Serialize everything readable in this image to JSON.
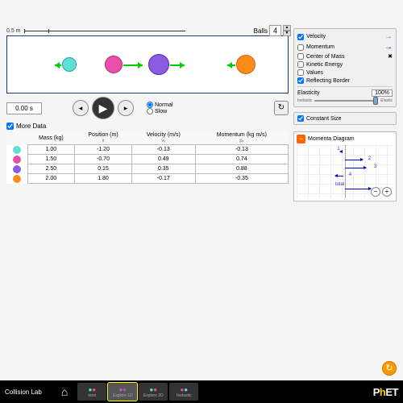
{
  "ruler_label": "0.5 m",
  "balls_control": {
    "label": "Balls",
    "value": "4"
  },
  "time": "0.00 s",
  "speed": {
    "normal": "Normal",
    "slow": "Slow"
  },
  "more_data": "More Data",
  "table": {
    "headers": {
      "mass": "Mass (kg)",
      "position": "Position (m)",
      "position_sub": "x",
      "velocity": "Velocity (m/s)",
      "velocity_sub": "vₓ",
      "momentum": "Momentum (kg m/s)",
      "momentum_sub": "pₓ"
    },
    "rows": [
      {
        "mass": "1.00",
        "pos": "-1.20",
        "vel": "-0.13",
        "mom": "-0.13"
      },
      {
        "mass": "1.50",
        "pos": "-0.70",
        "vel": "0.49",
        "mom": "0.74"
      },
      {
        "mass": "2.50",
        "pos": "0.15",
        "vel": "0.35",
        "mom": "0.88"
      },
      {
        "mass": "2.00",
        "pos": "1.80",
        "vel": "-0.17",
        "mom": "-0.35"
      }
    ]
  },
  "options": {
    "velocity": "Velocity",
    "momentum": "Momentum",
    "com": "Center of Mass",
    "ke": "Kinetic Energy",
    "values": "Values",
    "reflecting": "Reflecting Border"
  },
  "elasticity": {
    "label": "Elasticity",
    "value": "100%",
    "inelastic": "Inelastic",
    "elastic": "Elastic"
  },
  "constant_size": "Constant Size",
  "diagram": {
    "title": "Momenta Diagram",
    "total": "total",
    "labels": [
      "1",
      "2",
      "3",
      "4"
    ]
  },
  "nav": {
    "title": "Collision Lab",
    "tabs": [
      "Intro",
      "Explore 1D",
      "Explore 2D",
      "Inelastic"
    ]
  },
  "brand": {
    "p1": "P",
    "h": "h",
    "p2": "ET"
  },
  "colors": {
    "b1": "#5ce0d8",
    "b2": "#e84fa8",
    "b3": "#8b5ce0",
    "b4": "#ff8c1a"
  }
}
